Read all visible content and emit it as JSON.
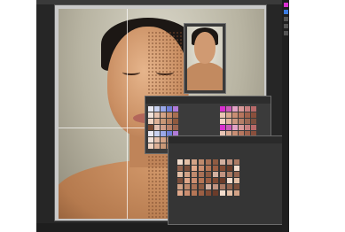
{
  "status_bar": {
    "zoom": "",
    "doc_info": ""
  },
  "panels": {
    "swatches_title": "",
    "brushes_title": ""
  },
  "colors": {
    "accent": "#d92fd0",
    "panel_bg": "#3b3b3b",
    "workspace_bg": "#262626"
  },
  "icons": [
    "brush-icon",
    "layer-icon",
    "color-icon"
  ]
}
